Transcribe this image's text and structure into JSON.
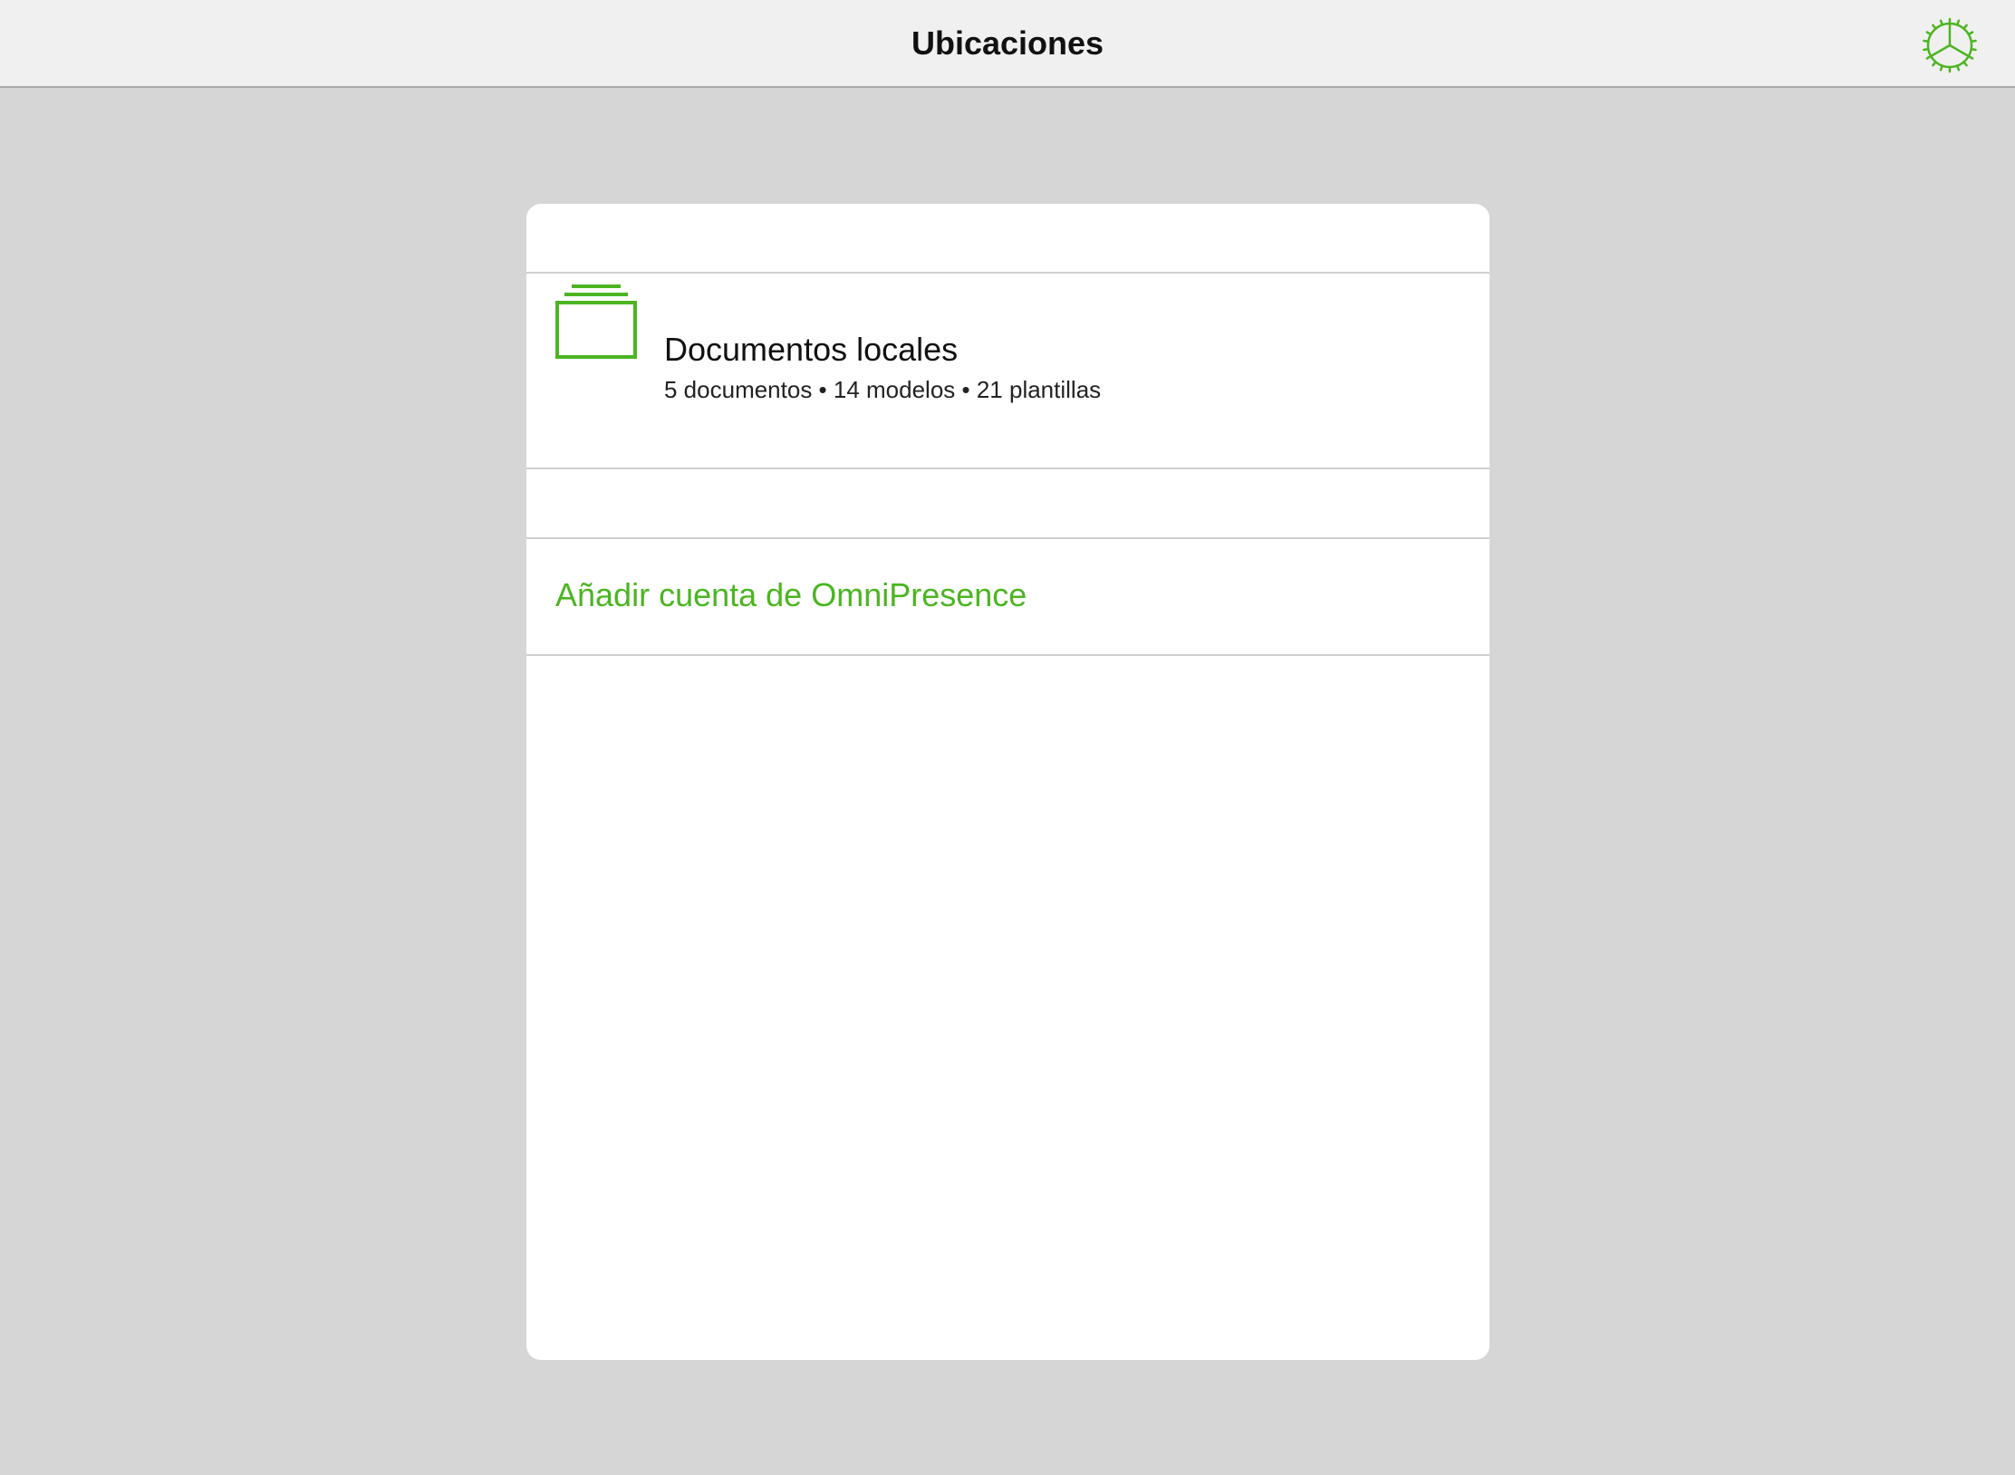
{
  "colors": {
    "accent": "#4cb522",
    "background": "#d6d6d6",
    "navbar": "#f0f0f0",
    "card": "#ffffff",
    "separator": "#cfcfd3"
  },
  "navbar": {
    "title": "Ubicaciones",
    "settings_icon": "gear-icon"
  },
  "locations": {
    "local": {
      "icon": "folder-stack-icon",
      "title": "Documentos locales",
      "subtitle": "5 documentos • 14 modelos • 21 plantillas"
    },
    "add_account": {
      "label": "Añadir cuenta de OmniPresence"
    }
  }
}
